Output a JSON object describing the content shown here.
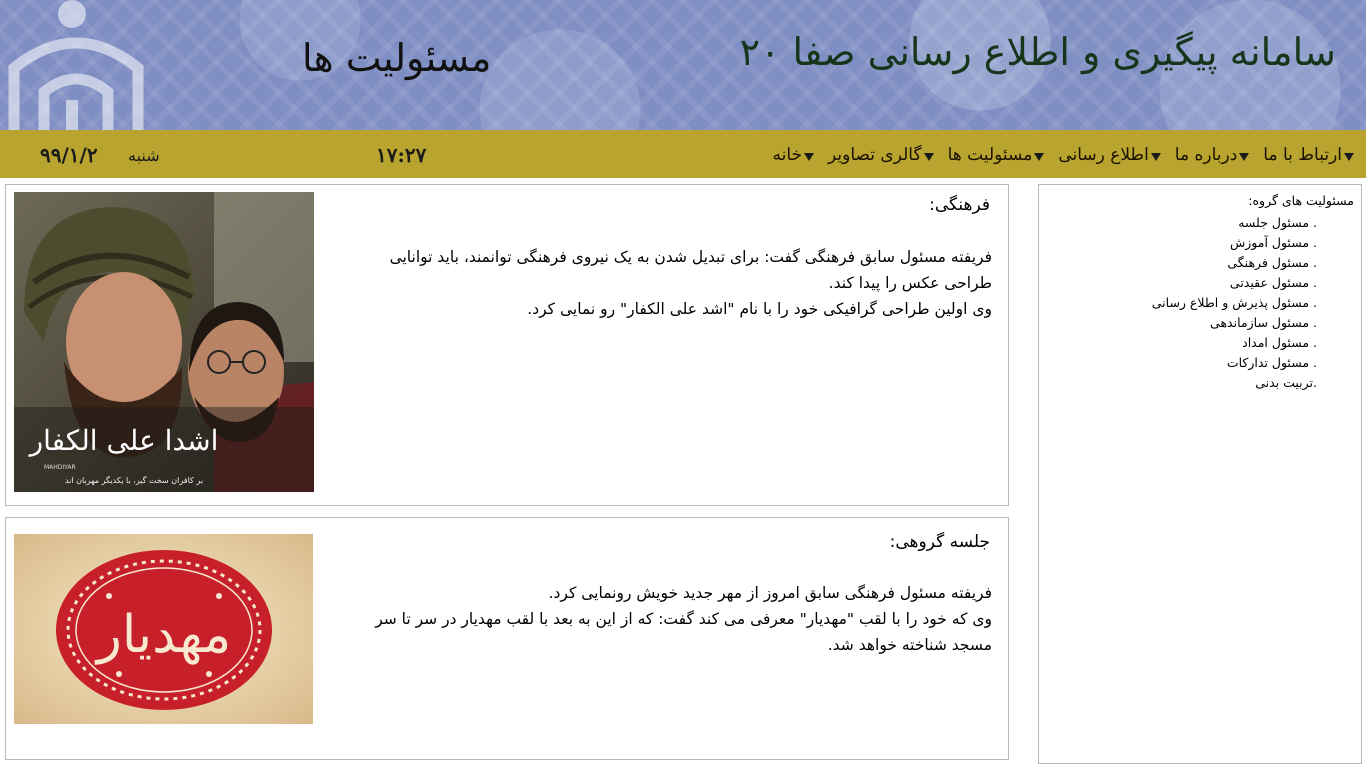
{
  "header": {
    "site_title": "سامانه پیگیری و اطلاع رسانی صفا ۲۰",
    "page_title": "مسئولیت ها"
  },
  "nav": {
    "items": [
      {
        "label": "خانه"
      },
      {
        "label": "گالری تصاویر"
      },
      {
        "label": "مسئولیت ها"
      },
      {
        "label": "اطلاع رسانی"
      },
      {
        "label": "درباره ما"
      },
      {
        "label": "ارتباط با ما"
      }
    ],
    "time": "۱۷:۲۷",
    "day": "شنبه",
    "date": "۹۹/۱/۲"
  },
  "cards": [
    {
      "heading": "فرهنگی:",
      "lines": [
        "فریفته  مسئول سابق فرهنگی گفت: برای تبدیل شدن به یک نیروی فرهنگی توانمند، باید توانایی طراحی عکس را پیدا کند.",
        "وی اولین طراحی گرافیکی خود را با نام \"اشد علی الکفار\" رو نمایی کرد."
      ],
      "image_caption": "بر کافران سخت گیر، با یکدیگر مهربان اند",
      "image_brand": "MAHDIYAR"
    },
    {
      "heading": "جلسه گروهی:",
      "lines": [
        "فریفته مسئول فرهنگی سابق امروز از مهر جدید خویش رونمایی کرد.",
        "وی که خود را با لقب \"مهدیار\" معرفی می کند گفت: که از این به بعد با لقب مهدیار در سر تا سر مسجد شناخته خواهد شد."
      ],
      "image_text": "مهدیار"
    }
  ],
  "sidebar": {
    "title": "مسئولیت های گروه:",
    "items": [
      ". مسئول جلسه",
      ". مسئول آموزش",
      ". مسئول فرهنگی",
      ". مسئول عقیدتی",
      ". مسئول پذیرش و اطلاع رسانی",
      ". مسئول سازماندهی",
      ". مسئول امداد",
      ". مسئول تدارکات",
      ".تربیت بدنی"
    ]
  },
  "colors": {
    "header_bg": "#7f8fc4",
    "nav_bg": "#b8a42e",
    "site_title": "#16361c"
  }
}
